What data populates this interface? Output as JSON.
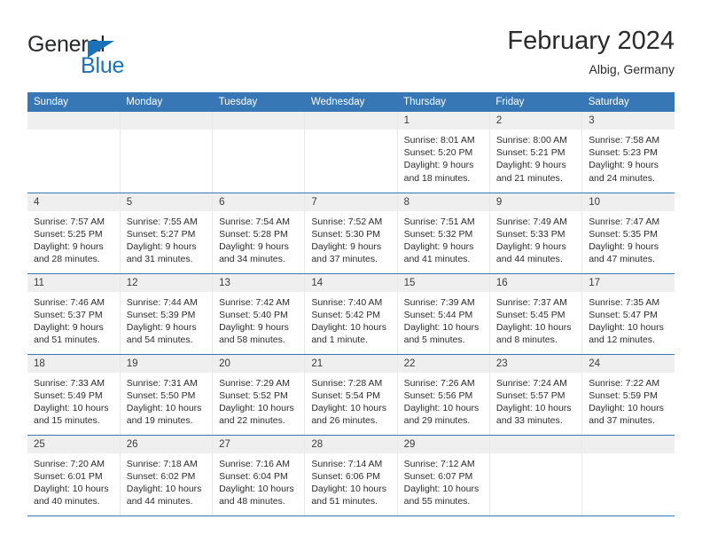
{
  "logo": {
    "text_top": "General",
    "text_bottom": "Blue",
    "color_dark": "#28292b",
    "color_blue": "#1a72b8"
  },
  "header": {
    "title": "February 2024",
    "subtitle": "Albig, Germany",
    "accent_color": "#3877b5"
  },
  "weekday_headers": [
    "Sunday",
    "Monday",
    "Tuesday",
    "Wednesday",
    "Thursday",
    "Friday",
    "Saturday"
  ],
  "weeks": [
    [
      {
        "day": "",
        "sunrise": "",
        "sunset": "",
        "daylight1": "",
        "daylight2": ""
      },
      {
        "day": "",
        "sunrise": "",
        "sunset": "",
        "daylight1": "",
        "daylight2": ""
      },
      {
        "day": "",
        "sunrise": "",
        "sunset": "",
        "daylight1": "",
        "daylight2": ""
      },
      {
        "day": "",
        "sunrise": "",
        "sunset": "",
        "daylight1": "",
        "daylight2": ""
      },
      {
        "day": "1",
        "sunrise": "Sunrise: 8:01 AM",
        "sunset": "Sunset: 5:20 PM",
        "daylight1": "Daylight: 9 hours",
        "daylight2": "and 18 minutes."
      },
      {
        "day": "2",
        "sunrise": "Sunrise: 8:00 AM",
        "sunset": "Sunset: 5:21 PM",
        "daylight1": "Daylight: 9 hours",
        "daylight2": "and 21 minutes."
      },
      {
        "day": "3",
        "sunrise": "Sunrise: 7:58 AM",
        "sunset": "Sunset: 5:23 PM",
        "daylight1": "Daylight: 9 hours",
        "daylight2": "and 24 minutes."
      }
    ],
    [
      {
        "day": "4",
        "sunrise": "Sunrise: 7:57 AM",
        "sunset": "Sunset: 5:25 PM",
        "daylight1": "Daylight: 9 hours",
        "daylight2": "and 28 minutes."
      },
      {
        "day": "5",
        "sunrise": "Sunrise: 7:55 AM",
        "sunset": "Sunset: 5:27 PM",
        "daylight1": "Daylight: 9 hours",
        "daylight2": "and 31 minutes."
      },
      {
        "day": "6",
        "sunrise": "Sunrise: 7:54 AM",
        "sunset": "Sunset: 5:28 PM",
        "daylight1": "Daylight: 9 hours",
        "daylight2": "and 34 minutes."
      },
      {
        "day": "7",
        "sunrise": "Sunrise: 7:52 AM",
        "sunset": "Sunset: 5:30 PM",
        "daylight1": "Daylight: 9 hours",
        "daylight2": "and 37 minutes."
      },
      {
        "day": "8",
        "sunrise": "Sunrise: 7:51 AM",
        "sunset": "Sunset: 5:32 PM",
        "daylight1": "Daylight: 9 hours",
        "daylight2": "and 41 minutes."
      },
      {
        "day": "9",
        "sunrise": "Sunrise: 7:49 AM",
        "sunset": "Sunset: 5:33 PM",
        "daylight1": "Daylight: 9 hours",
        "daylight2": "and 44 minutes."
      },
      {
        "day": "10",
        "sunrise": "Sunrise: 7:47 AM",
        "sunset": "Sunset: 5:35 PM",
        "daylight1": "Daylight: 9 hours",
        "daylight2": "and 47 minutes."
      }
    ],
    [
      {
        "day": "11",
        "sunrise": "Sunrise: 7:46 AM",
        "sunset": "Sunset: 5:37 PM",
        "daylight1": "Daylight: 9 hours",
        "daylight2": "and 51 minutes."
      },
      {
        "day": "12",
        "sunrise": "Sunrise: 7:44 AM",
        "sunset": "Sunset: 5:39 PM",
        "daylight1": "Daylight: 9 hours",
        "daylight2": "and 54 minutes."
      },
      {
        "day": "13",
        "sunrise": "Sunrise: 7:42 AM",
        "sunset": "Sunset: 5:40 PM",
        "daylight1": "Daylight: 9 hours",
        "daylight2": "and 58 minutes."
      },
      {
        "day": "14",
        "sunrise": "Sunrise: 7:40 AM",
        "sunset": "Sunset: 5:42 PM",
        "daylight1": "Daylight: 10 hours",
        "daylight2": "and 1 minute."
      },
      {
        "day": "15",
        "sunrise": "Sunrise: 7:39 AM",
        "sunset": "Sunset: 5:44 PM",
        "daylight1": "Daylight: 10 hours",
        "daylight2": "and 5 minutes."
      },
      {
        "day": "16",
        "sunrise": "Sunrise: 7:37 AM",
        "sunset": "Sunset: 5:45 PM",
        "daylight1": "Daylight: 10 hours",
        "daylight2": "and 8 minutes."
      },
      {
        "day": "17",
        "sunrise": "Sunrise: 7:35 AM",
        "sunset": "Sunset: 5:47 PM",
        "daylight1": "Daylight: 10 hours",
        "daylight2": "and 12 minutes."
      }
    ],
    [
      {
        "day": "18",
        "sunrise": "Sunrise: 7:33 AM",
        "sunset": "Sunset: 5:49 PM",
        "daylight1": "Daylight: 10 hours",
        "daylight2": "and 15 minutes."
      },
      {
        "day": "19",
        "sunrise": "Sunrise: 7:31 AM",
        "sunset": "Sunset: 5:50 PM",
        "daylight1": "Daylight: 10 hours",
        "daylight2": "and 19 minutes."
      },
      {
        "day": "20",
        "sunrise": "Sunrise: 7:29 AM",
        "sunset": "Sunset: 5:52 PM",
        "daylight1": "Daylight: 10 hours",
        "daylight2": "and 22 minutes."
      },
      {
        "day": "21",
        "sunrise": "Sunrise: 7:28 AM",
        "sunset": "Sunset: 5:54 PM",
        "daylight1": "Daylight: 10 hours",
        "daylight2": "and 26 minutes."
      },
      {
        "day": "22",
        "sunrise": "Sunrise: 7:26 AM",
        "sunset": "Sunset: 5:56 PM",
        "daylight1": "Daylight: 10 hours",
        "daylight2": "and 29 minutes."
      },
      {
        "day": "23",
        "sunrise": "Sunrise: 7:24 AM",
        "sunset": "Sunset: 5:57 PM",
        "daylight1": "Daylight: 10 hours",
        "daylight2": "and 33 minutes."
      },
      {
        "day": "24",
        "sunrise": "Sunrise: 7:22 AM",
        "sunset": "Sunset: 5:59 PM",
        "daylight1": "Daylight: 10 hours",
        "daylight2": "and 37 minutes."
      }
    ],
    [
      {
        "day": "25",
        "sunrise": "Sunrise: 7:20 AM",
        "sunset": "Sunset: 6:01 PM",
        "daylight1": "Daylight: 10 hours",
        "daylight2": "and 40 minutes."
      },
      {
        "day": "26",
        "sunrise": "Sunrise: 7:18 AM",
        "sunset": "Sunset: 6:02 PM",
        "daylight1": "Daylight: 10 hours",
        "daylight2": "and 44 minutes."
      },
      {
        "day": "27",
        "sunrise": "Sunrise: 7:16 AM",
        "sunset": "Sunset: 6:04 PM",
        "daylight1": "Daylight: 10 hours",
        "daylight2": "and 48 minutes."
      },
      {
        "day": "28",
        "sunrise": "Sunrise: 7:14 AM",
        "sunset": "Sunset: 6:06 PM",
        "daylight1": "Daylight: 10 hours",
        "daylight2": "and 51 minutes."
      },
      {
        "day": "29",
        "sunrise": "Sunrise: 7:12 AM",
        "sunset": "Sunset: 6:07 PM",
        "daylight1": "Daylight: 10 hours",
        "daylight2": "and 55 minutes."
      },
      {
        "day": "",
        "sunrise": "",
        "sunset": "",
        "daylight1": "",
        "daylight2": ""
      },
      {
        "day": "",
        "sunrise": "",
        "sunset": "",
        "daylight1": "",
        "daylight2": ""
      }
    ]
  ]
}
